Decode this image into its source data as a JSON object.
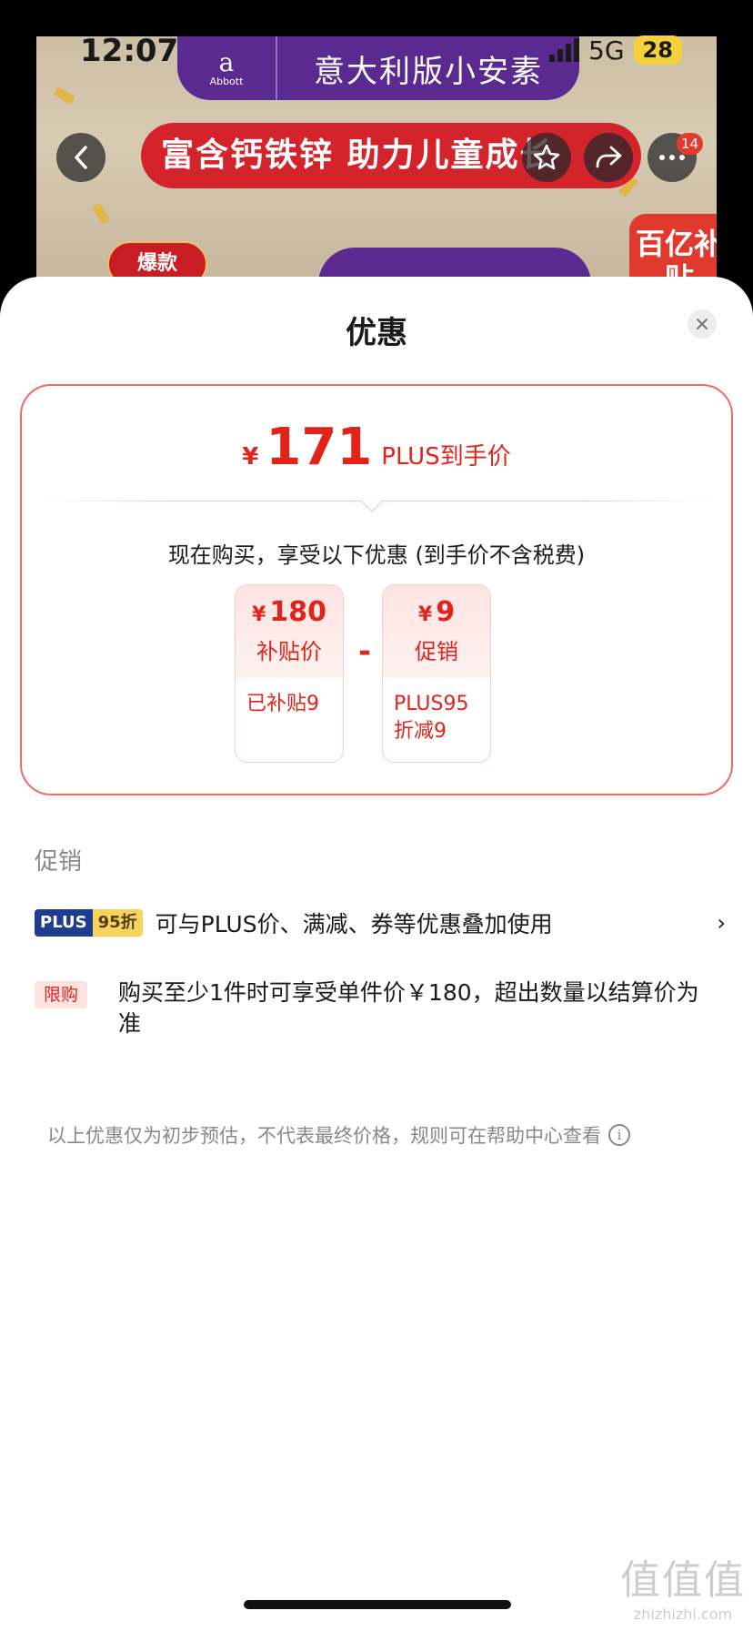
{
  "status_bar": {
    "time": "12:07",
    "network": "5G",
    "battery": "28"
  },
  "background": {
    "brand_logo_text": "Abbott",
    "brand_title": "意大利版小安素",
    "slogan": "富含钙铁锌 助力儿童成长",
    "hot_tag": "爆款",
    "subsidy_tag": "百亿补贴",
    "notification_count": "14"
  },
  "sheet": {
    "title": "优惠",
    "price": {
      "symbol": "¥",
      "amount": "171",
      "label": "PLUS到手价"
    },
    "buy_now_text": "现在购买，享受以下优惠 (到手价不含税费)",
    "breakdown": [
      {
        "amount": "180",
        "kind": "补贴价",
        "detail": "已补贴9"
      },
      {
        "amount": "9",
        "kind": "促销",
        "detail": "PLUS95折减9"
      }
    ],
    "minus_sign": "-",
    "section_label": "促销",
    "promo": {
      "badge_left": "PLUS",
      "badge_right": "95折",
      "text": "可与PLUS价、满减、券等优惠叠加使用"
    },
    "limit": {
      "badge": "限购",
      "text": "购买至少1件时可享受单件价￥180，超出数量以结算价为准"
    },
    "disclaimer": "以上优惠仅为初步预估，不代表最终价格，规则可在帮助中心查看"
  },
  "watermark": {
    "big": "值值值",
    "small": "zhizhizhi.com"
  },
  "colors": {
    "accent": "#e2231a",
    "brand_purple": "#5a2a91",
    "plus_blue": "#1f3c8f",
    "plus_gold": "#f5d55c"
  }
}
